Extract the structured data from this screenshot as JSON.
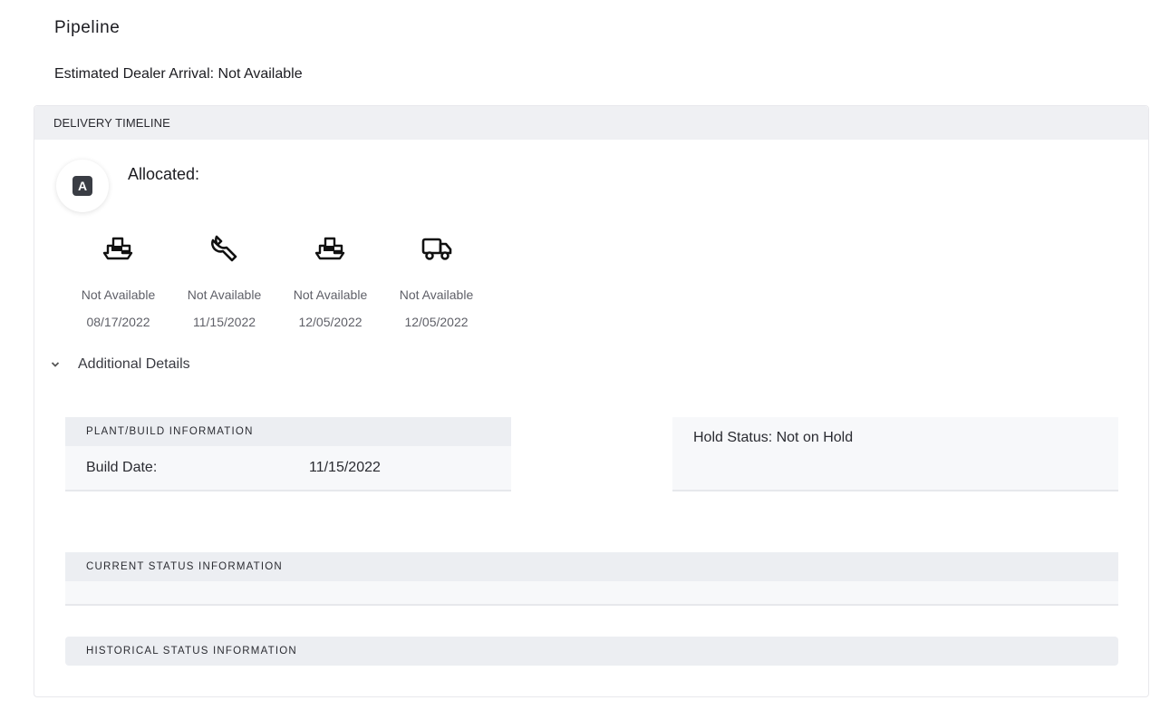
{
  "page": {
    "title": "Pipeline",
    "eta": "Estimated Dealer Arrival: Not Available"
  },
  "timeline": {
    "header": "DELIVERY TIMELINE",
    "status_letter": "A",
    "status_label": "Allocated:",
    "milestones": [
      {
        "icon": "ship-icon",
        "status": "Not Available",
        "date": "08/17/2022"
      },
      {
        "icon": "wrench-icon",
        "status": "Not Available",
        "date": "11/15/2022"
      },
      {
        "icon": "ship-icon",
        "status": "Not Available",
        "date": "12/05/2022"
      },
      {
        "icon": "truck-icon",
        "status": "Not Available",
        "date": "12/05/2022"
      }
    ]
  },
  "details": {
    "toggle_label": "Additional Details",
    "plant": {
      "header": "PLANT/BUILD INFORMATION",
      "build_date_label": "Build Date:",
      "build_date_value": "11/15/2022"
    },
    "hold_status": "Hold Status: Not on Hold",
    "current_status_header": "CURRENT STATUS INFORMATION",
    "historical_status_header": "HISTORICAL STATUS INFORMATION"
  },
  "colors": {
    "header_bg": "#eff0f3",
    "panel_bg": "#f7f8fa",
    "status_badge": "#3a3d44",
    "muted_text": "#5f6068"
  }
}
